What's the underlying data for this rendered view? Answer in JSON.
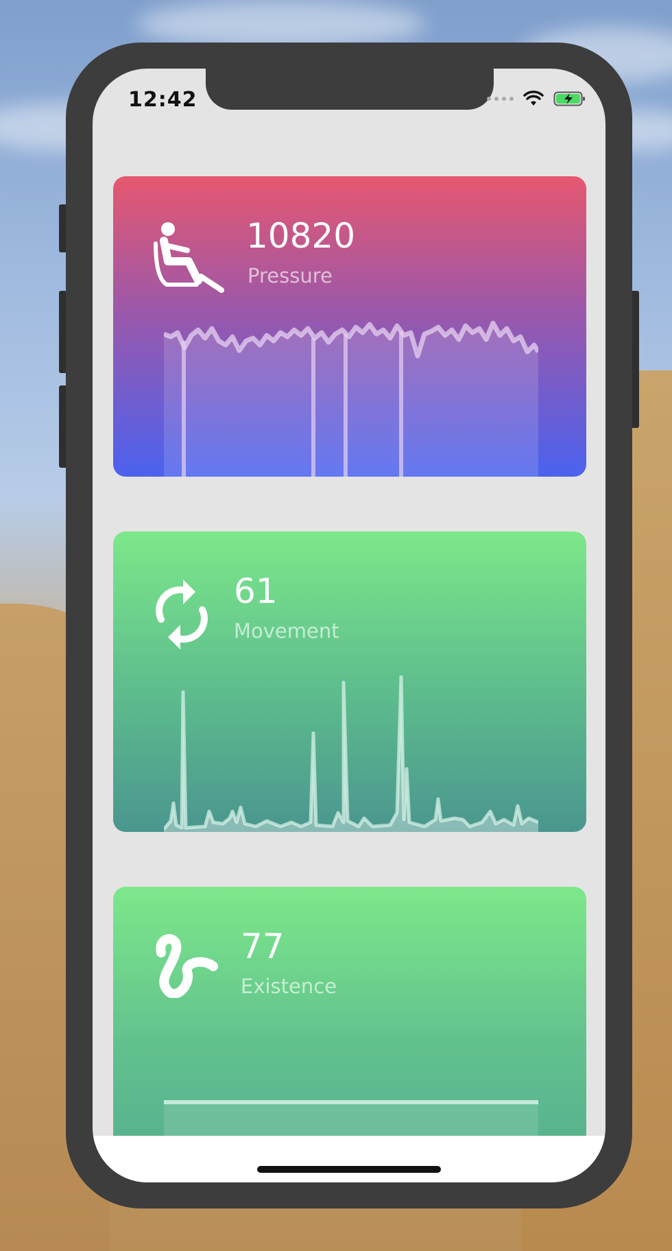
{
  "status_bar": {
    "time": "12:42"
  },
  "cards": [
    {
      "value": "10820",
      "label": "Pressure",
      "icon": "seated-person-icon",
      "gradient": [
        "#e6586f",
        "#9b58aa",
        "#4b62ef"
      ]
    },
    {
      "value": "61",
      "label": "Movement",
      "icon": "refresh-cycle-icon",
      "gradient": [
        "#7de88a",
        "#5fbf8d",
        "#4a968e"
      ]
    },
    {
      "value": "77",
      "label": "Existence",
      "icon": "squiggle-icon",
      "gradient": [
        "#7de88a",
        "#62c28e",
        "#4fa58f"
      ]
    }
  ]
}
